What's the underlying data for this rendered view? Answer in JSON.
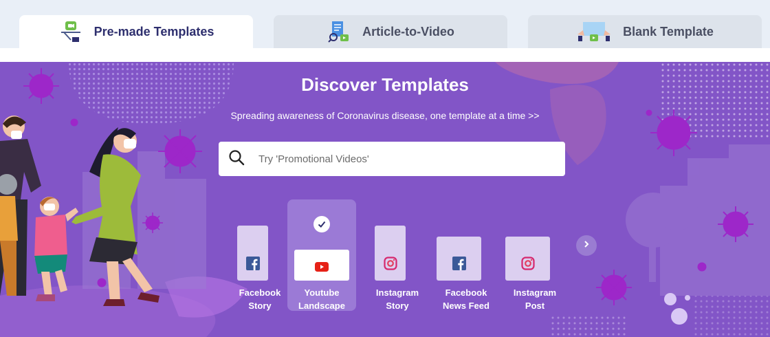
{
  "tabs": [
    {
      "label": "Pre-made Templates",
      "icon": "video-tray-icon",
      "active": true
    },
    {
      "label": "Article-to-Video",
      "icon": "document-to-video-icon",
      "active": false
    },
    {
      "label": "Blank Template",
      "icon": "blank-canvas-icon",
      "active": false
    }
  ],
  "hero": {
    "title": "Discover Templates",
    "subtitle": "Spreading awareness of Coronavirus disease, one template at a time >>"
  },
  "search": {
    "placeholder": "Try 'Promotional Videos'",
    "icon": "search-icon"
  },
  "formats": [
    {
      "line1": "Facebook",
      "line2": "Story",
      "icon": "facebook-icon",
      "selected": false
    },
    {
      "line1": "Youtube",
      "line2": "Landscape",
      "icon": "youtube-icon",
      "selected": true
    },
    {
      "line1": "Instagram",
      "line2": "Story",
      "icon": "instagram-icon",
      "selected": false
    },
    {
      "line1": "Facebook",
      "line2": "News Feed",
      "icon": "facebook-icon",
      "selected": false
    },
    {
      "line1": "Instagram",
      "line2": "Post",
      "icon": "instagram-icon",
      "selected": false
    }
  ],
  "colors": {
    "hero_bg": "#8255c7",
    "tab_active_text": "#2e2f6e",
    "virus": "#9d27c9",
    "youtube_red": "#e62117",
    "facebook_blue": "#3b5998"
  }
}
